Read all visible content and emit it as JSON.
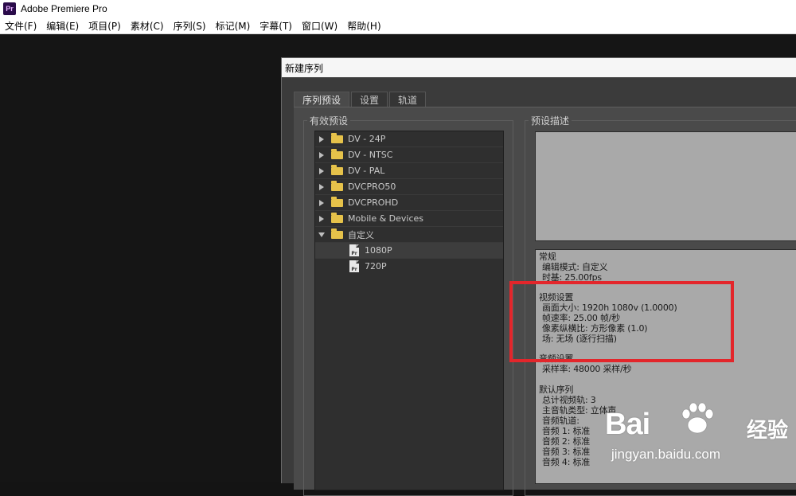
{
  "app": {
    "icon_text": "Pr",
    "title": "Adobe Premiere Pro"
  },
  "menu": [
    "文件(F)",
    "编辑(E)",
    "项目(P)",
    "素材(C)",
    "序列(S)",
    "标记(M)",
    "字幕(T)",
    "窗口(W)",
    "帮助(H)"
  ],
  "dialog": {
    "title": "新建序列",
    "tabs": [
      "序列预设",
      "设置",
      "轨道"
    ],
    "active_tab": "序列预设",
    "presets_label": "有效预设",
    "description_label": "预设描述",
    "presets": [
      {
        "label": "DV - 24P",
        "type": "folder",
        "expanded": false
      },
      {
        "label": "DV - NTSC",
        "type": "folder",
        "expanded": false
      },
      {
        "label": "DV - PAL",
        "type": "folder",
        "expanded": false
      },
      {
        "label": "DVCPRO50",
        "type": "folder",
        "expanded": false
      },
      {
        "label": "DVCPROHD",
        "type": "folder",
        "expanded": false
      },
      {
        "label": "Mobile & Devices",
        "type": "folder",
        "expanded": false
      },
      {
        "label": "自定义",
        "type": "folder",
        "expanded": true
      },
      {
        "label": "1080P",
        "type": "file",
        "selected": true
      },
      {
        "label": "720P",
        "type": "file",
        "selected": false
      }
    ],
    "file_icon_text": "Pr",
    "info": {
      "general_header": "常规",
      "edit_mode": "编辑模式: 自定义",
      "timebase": "时基: 25.00fps",
      "video_header": "视频设置",
      "frame_size": "画面大小: 1920h 1080v (1.0000)",
      "frame_rate": "帧速率: 25.00 帧/秒",
      "pixel_aspect": "像素纵横比: 方形像素 (1.0)",
      "fields": "场: 无场 (逐行扫描)",
      "audio_header": "音频设置",
      "sample_rate": "采样率: 48000 采样/秒",
      "default_seq_header": "默认序列",
      "total_video_tracks": "总计视频轨: 3",
      "master_track_type": "主音轨类型: 立体声",
      "audio_tracks": "音频轨道:",
      "audio1": "音频 1: 标准",
      "audio2": "音频 2: 标准",
      "audio3": "音频 3: 标准",
      "audio4": "音频 4: 标准"
    }
  },
  "annotation": {
    "highlight_color": "#e3262b"
  },
  "watermark": {
    "logo": "Bai",
    "logo2": "经验",
    "url": "jingyan.baidu.com"
  }
}
